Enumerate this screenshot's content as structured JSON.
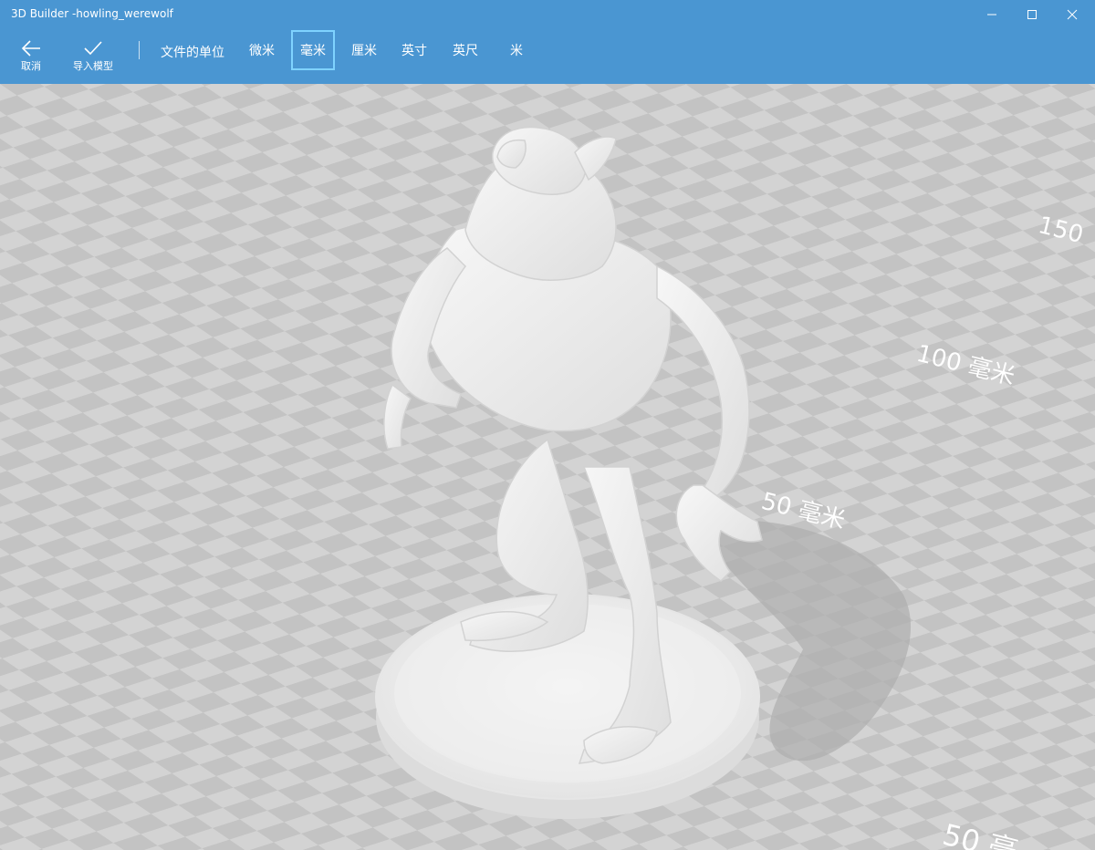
{
  "window": {
    "title": "3D Builder -howling_werewolf"
  },
  "toolbar": {
    "back_label": "取消",
    "import_label": "导入模型",
    "units_label": "文件的单位",
    "units": [
      {
        "label": "微米",
        "selected": false
      },
      {
        "label": "毫米",
        "selected": true
      },
      {
        "label": "厘米",
        "selected": false
      },
      {
        "label": "英寸",
        "selected": false
      },
      {
        "label": "英尺",
        "selected": false
      },
      {
        "label": "米",
        "selected": false
      }
    ]
  },
  "rulers": {
    "r150": "150",
    "r100": "100 毫米",
    "r50": "50 毫米",
    "r50b": "50 毫"
  },
  "colors": {
    "toolbar": "#4a96d2",
    "floor_light": "#d3d3d3",
    "floor_dark": "#c2c2c2",
    "model": "#f2f2f2",
    "selected_unit_border": "#7fd3ff"
  },
  "icons": {
    "back": "arrow-left-icon",
    "import": "checkmark-icon",
    "minimize": "minimize-icon",
    "maximize": "maximize-icon",
    "close": "close-icon"
  }
}
